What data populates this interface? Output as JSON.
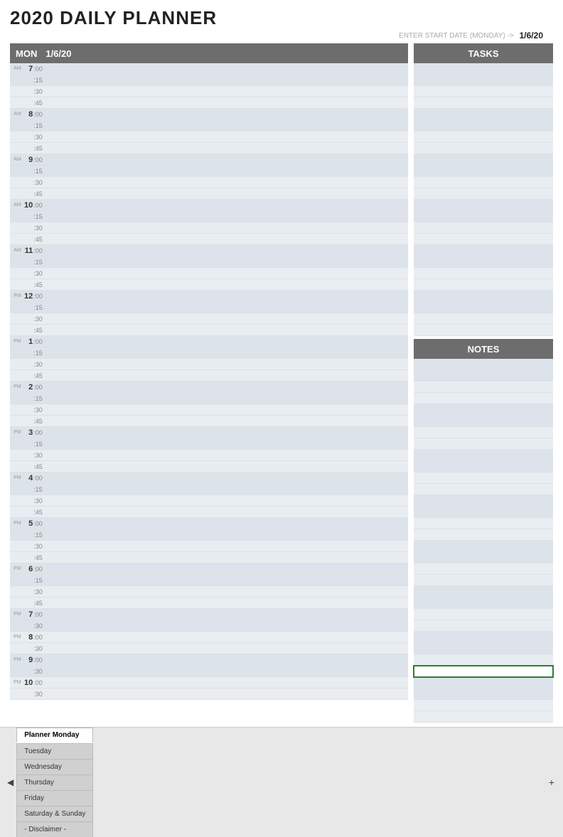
{
  "header": {
    "title": "2020 DAILY PLANNER",
    "start_date_label": "ENTER START DATE (MONDAY) ->",
    "start_date_value": "1/6/20"
  },
  "schedule": {
    "day": "MON",
    "date": "1/6/20"
  },
  "tasks_header": "TASKS",
  "notes_header": "NOTES",
  "tabs": [
    {
      "id": "planner-monday",
      "label": "Planner Monday",
      "active": true
    },
    {
      "id": "tuesday",
      "label": "Tuesday",
      "active": false
    },
    {
      "id": "wednesday",
      "label": "Wednesday",
      "active": false
    },
    {
      "id": "thursday",
      "label": "Thursday",
      "active": false
    },
    {
      "id": "friday",
      "label": "Friday",
      "active": false
    },
    {
      "id": "saturday-sunday",
      "label": "Saturday & Sunday",
      "active": false
    },
    {
      "id": "disclaimer",
      "label": "- Disclaimer -",
      "active": false
    }
  ],
  "time_slots": [
    {
      "hour": "7",
      "ampm": "AM",
      "rows": [
        ":00",
        ":15",
        ":30",
        ":45"
      ]
    },
    {
      "hour": "8",
      "ampm": "AM",
      "rows": [
        ":00",
        ":15",
        ":30",
        ":45"
      ]
    },
    {
      "hour": "9",
      "ampm": "AM",
      "rows": [
        ":00",
        ":15",
        ":30",
        ":45"
      ]
    },
    {
      "hour": "10",
      "ampm": "AM",
      "rows": [
        ":00",
        ":15",
        ":30",
        ":45"
      ]
    },
    {
      "hour": "11",
      "ampm": "AM",
      "rows": [
        ":00",
        ":15",
        ":30",
        ":45"
      ]
    },
    {
      "hour": "12",
      "ampm": "PM",
      "rows": [
        ":00",
        ":15",
        ":30",
        ":45"
      ]
    },
    {
      "hour": "1",
      "ampm": "PM",
      "rows": [
        ":00",
        ":15",
        ":30",
        ":45"
      ]
    },
    {
      "hour": "2",
      "ampm": "PM",
      "rows": [
        ":00",
        ":15",
        ":30",
        ":45"
      ]
    },
    {
      "hour": "3",
      "ampm": "PM",
      "rows": [
        ":00",
        ":15",
        ":30",
        ":45"
      ]
    },
    {
      "hour": "4",
      "ampm": "PM",
      "rows": [
        ":00",
        ":15",
        ":30",
        ":45"
      ]
    },
    {
      "hour": "5",
      "ampm": "PM",
      "rows": [
        ":00",
        ":15",
        ":30",
        ":45"
      ]
    },
    {
      "hour": "6",
      "ampm": "PM",
      "rows": [
        ":00",
        ":15",
        ":30",
        ":45"
      ]
    },
    {
      "hour": "7",
      "ampm": "PM",
      "rows": [
        ":00",
        ":30"
      ]
    },
    {
      "hour": "8",
      "ampm": "PM",
      "rows": [
        ":00",
        ":30"
      ]
    },
    {
      "hour": "9",
      "ampm": "PM",
      "rows": [
        ":00",
        ":30"
      ]
    },
    {
      "hour": "10",
      "ampm": "PM",
      "rows": [
        ":00",
        ":30"
      ]
    }
  ]
}
